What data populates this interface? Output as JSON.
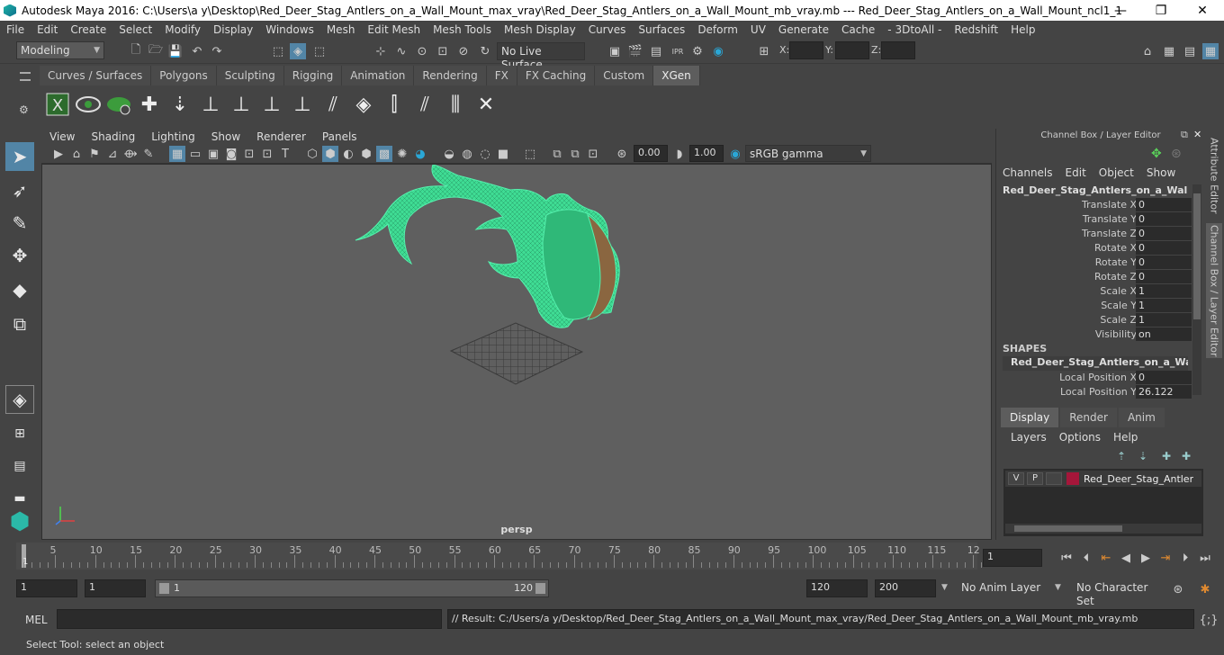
{
  "window": {
    "title": "Autodesk Maya 2016: C:\\Users\\a y\\Desktop\\Red_Deer_Stag_Antlers_on_a_Wall_Mount_max_vray\\Red_Deer_Stag_Antlers_on_a_Wall_Mount_mb_vray.mb   ---   Red_Deer_Stag_Antlers_on_a_Wall_Mount_ncl1_1",
    "minimize": "—",
    "restore": "❐",
    "close": "✕"
  },
  "menubar": [
    "File",
    "Edit",
    "Create",
    "Select",
    "Modify",
    "Display",
    "Windows",
    "Mesh",
    "Edit Mesh",
    "Mesh Tools",
    "Mesh Display",
    "Curves",
    "Surfaces",
    "Deform",
    "UV",
    "Generate",
    "Cache",
    "- 3DtoAll -",
    "Redshift",
    "Help"
  ],
  "statusline": {
    "mode": "Modeling",
    "live_surface": "No Live Surface",
    "x_label": "X:",
    "y_label": "Y:",
    "z_label": "Z:"
  },
  "shelf_tabs": [
    {
      "label": "Curves / Surfaces"
    },
    {
      "label": "Polygons"
    },
    {
      "label": "Sculpting"
    },
    {
      "label": "Rigging"
    },
    {
      "label": "Animation"
    },
    {
      "label": "Rendering"
    },
    {
      "label": "FX"
    },
    {
      "label": "FX Caching"
    },
    {
      "label": "Custom"
    },
    {
      "label": "XGen",
      "active": true
    }
  ],
  "viewport": {
    "menus": [
      "View",
      "Shading",
      "Lighting",
      "Show",
      "Renderer",
      "Panels"
    ],
    "near_value": "0.00",
    "far_value": "1.00",
    "color_space": "sRGB gamma",
    "camera": "persp"
  },
  "channel_box": {
    "title": "Channel Box / Layer Editor",
    "menus": [
      "Channels",
      "Edit",
      "Object",
      "Show"
    ],
    "object_name": "Red_Deer_Stag_Antlers_on_a_Wall_M...",
    "attributes": [
      {
        "label": "Translate X",
        "value": "0"
      },
      {
        "label": "Translate Y",
        "value": "0"
      },
      {
        "label": "Translate Z",
        "value": "0"
      },
      {
        "label": "Rotate X",
        "value": "0"
      },
      {
        "label": "Rotate Y",
        "value": "0"
      },
      {
        "label": "Rotate Z",
        "value": "0"
      },
      {
        "label": "Scale X",
        "value": "1"
      },
      {
        "label": "Scale Y",
        "value": "1"
      },
      {
        "label": "Scale Z",
        "value": "1"
      },
      {
        "label": "Visibility",
        "value": "on"
      }
    ],
    "shapes_label": "SHAPES",
    "shape_name": "Red_Deer_Stag_Antlers_on_a_Wall_...",
    "shape_attributes": [
      {
        "label": "Local Position X",
        "value": "0"
      },
      {
        "label": "Local Position Y",
        "value": "26.122"
      }
    ]
  },
  "layer_editor": {
    "tabs": [
      "Display",
      "Render",
      "Anim"
    ],
    "menus": [
      "Layers",
      "Options",
      "Help"
    ],
    "layer": {
      "v": "V",
      "p": "P",
      "name": "Red_Deer_Stag_Antlers_on_a_Wall_Mount",
      "color": "#a5163a"
    }
  },
  "side_tabs": [
    "Attribute Editor",
    "Channel Box / Layer Editor"
  ],
  "timeline": {
    "labels": [
      "5",
      "10",
      "15",
      "20",
      "25",
      "30",
      "35",
      "40",
      "45",
      "50",
      "55",
      "60",
      "65",
      "70",
      "75",
      "80",
      "85",
      "90",
      "95",
      "100",
      "105",
      "110",
      "115",
      "12"
    ],
    "current_frame_marker": "1",
    "current_frame": "1"
  },
  "range": {
    "start": "1",
    "playback_start": "1",
    "slider_start": "1",
    "slider_end": "120",
    "playback_end": "120",
    "end": "200",
    "anim_layer": "No Anim Layer",
    "character_set": "No Character Set"
  },
  "command_line": {
    "lang": "MEL",
    "result": "// Result: C:/Users/a y/Desktop/Red_Deer_Stag_Antlers_on_a_Wall_Mount_max_vray/Red_Deer_Stag_Antlers_on_a_Wall_Mount_mb_vray.mb"
  },
  "help_line": "Select Tool: select an object",
  "colors": {
    "mesh_wire": "#4ee8a0",
    "accent_tab": "#5d5d5d",
    "layer_color": "#a5163a"
  }
}
